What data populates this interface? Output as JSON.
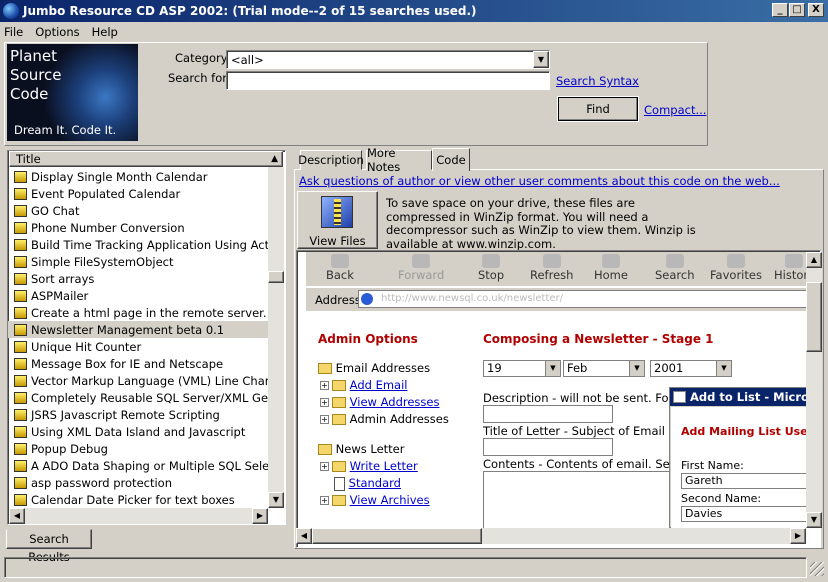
{
  "window": {
    "title": "Jumbo Resource CD ASP 2002: (Trial mode--2 of 15 searches used.)",
    "controls": {
      "minimize": "_",
      "maximize": "□",
      "close": "X"
    }
  },
  "menu": {
    "items": [
      "File",
      "Options",
      "Help"
    ]
  },
  "logo": {
    "line1": "Planet",
    "line2": "Source",
    "line3": "Code",
    "tagline": "Dream It.  Code It."
  },
  "search": {
    "category_label": "Category:",
    "category_value": "<all>",
    "search_label": "Search for:",
    "search_value": "",
    "syntax_link": "Search Syntax",
    "find_button": "Find",
    "compact_link": "Compact..."
  },
  "results": {
    "column_title": "Title",
    "items": [
      "Display Single Month Calendar",
      "Event Populated Calendar",
      "GO Chat",
      "Phone Number Conversion",
      "Build Time Tracking Application Using ActiveX Cor",
      "Simple FileSystemObject",
      "Sort arrays",
      "ASPMailer",
      "Create a html page in the remote server. (Dynamic)",
      "Newsletter Management beta 0.1",
      "Unique Hit Counter",
      "Message Box for IE and Netscape",
      "Vector Markup Language (VML) Line Chart",
      "Completely Reusable SQL Server/XML Generator",
      "JSRS Javascript Remote Scripting",
      "Using XML Data Island and Javascript",
      "Popup Debug",
      "A ADO Data Shaping or Multiple SQL Select",
      "asp password protection",
      "Calendar Date Picker for text boxes"
    ],
    "selected_index": 9,
    "tab_label": "Search Results"
  },
  "detail": {
    "tabs": [
      "Description",
      "More Notes",
      "Code"
    ],
    "active_tab": "Code",
    "ask_link": "Ask questions of author or view other user comments about this code on the web...",
    "view_files_label": "View Files",
    "winzip_note": "To save space on your drive, these files are compressed in WinZip format.  You will need a decompressor such as WinZip to view them.  Winzip is available at www.winzip.com."
  },
  "browser": {
    "toolbar": [
      "Back",
      "Forward",
      "Stop",
      "Refresh",
      "Home",
      "Search",
      "Favorites",
      "History"
    ],
    "address_label": "Address",
    "address_value": "http://www.newsql.co.uk/newsletter/",
    "admin_options": "Admin Options",
    "composing_title": "Composing a Newsletter - Stage 1",
    "tree": {
      "email_addresses": "Email Addresses",
      "add_email": "Add Email",
      "view_addresses": "View Addresses",
      "admin_addresses": "Admin Addresses",
      "news_letter": "News Letter",
      "write_letter": "Write Letter",
      "standard": "Standard",
      "view_archives": "View Archives"
    },
    "date": {
      "day": "19",
      "month": "Feb",
      "year": "2001"
    },
    "description_label": "Description - will not be sent. For archi",
    "title_label": "Title of Letter - Subject of Email",
    "contents_label": "Contents - Contents of email. See info",
    "popup": {
      "title": "Add to List - Microso",
      "heading": "Add Mailing List User -",
      "first_name_label": "First Name:",
      "first_name_value": "Gareth",
      "second_name_label": "Second Name:",
      "second_name_value": "Davies"
    }
  },
  "colors": {
    "title_bar": "#0a246a",
    "link": "#0000cc",
    "heading_red": "#b00000",
    "face": "#d4d0c8"
  }
}
